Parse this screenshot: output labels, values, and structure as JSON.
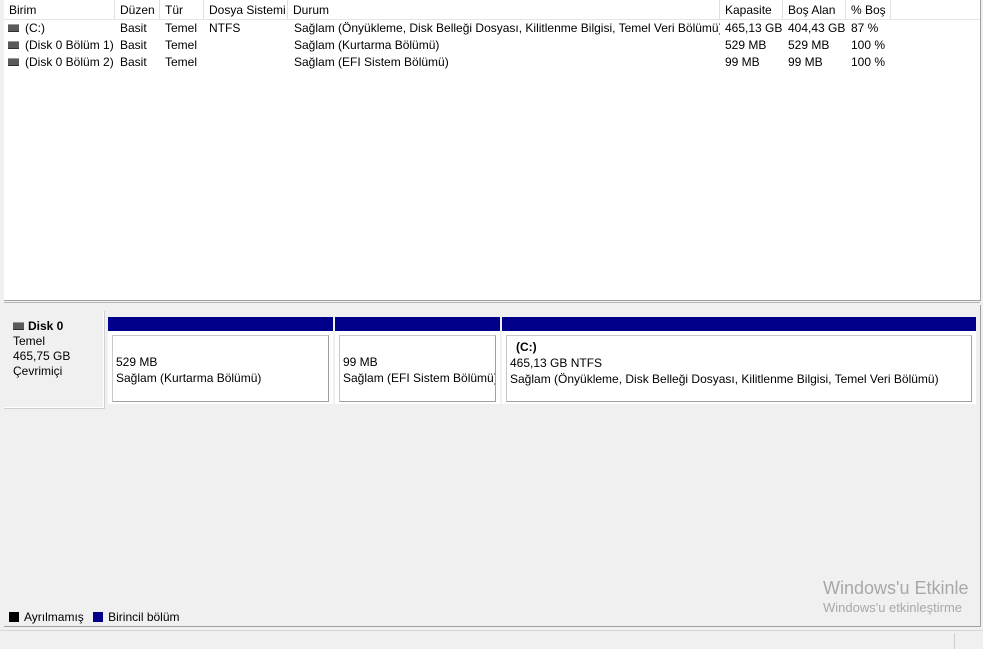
{
  "volume_list": {
    "columns": [
      "Birim",
      "Düzen",
      "Tür",
      "Dosya Sistemi",
      "Durum",
      "Kapasite",
      "Boş Alan",
      "% Boş"
    ],
    "rows": [
      {
        "icon": "disk-volume-icon",
        "name": "(C:)",
        "layout": "Basit",
        "type": "Temel",
        "fs": "NTFS",
        "status": "Sağlam (Önyükleme, Disk Belleği Dosyası, Kilitlenme Bilgisi, Temel Veri Bölümü)",
        "capacity": "465,13 GB",
        "free": "404,43 GB",
        "pct": "87 %"
      },
      {
        "icon": "disk-volume-icon",
        "name": "(Disk 0 Bölüm 1)",
        "layout": "Basit",
        "type": "Temel",
        "fs": "",
        "status": "Sağlam (Kurtarma Bölümü)",
        "capacity": "529 MB",
        "free": "529 MB",
        "pct": "100 %"
      },
      {
        "icon": "disk-volume-icon",
        "name": "(Disk 0 Bölüm 2)",
        "layout": "Basit",
        "type": "Temel",
        "fs": "",
        "status": "Sağlam (EFI Sistem Bölümü)",
        "capacity": "99 MB",
        "free": "99 MB",
        "pct": "100 %"
      }
    ]
  },
  "disk": {
    "icon": "disk-drive-icon",
    "name": "Disk 0",
    "type": "Temel",
    "size": "465,75 GB",
    "state": "Çevrimiçi",
    "partitions": [
      {
        "title": "",
        "size": "529 MB",
        "status": "Sağlam (Kurtarma Bölümü)"
      },
      {
        "title": "",
        "size": "99 MB",
        "status": "Sağlam (EFI Sistem Bölümü)"
      },
      {
        "title": "(C:)",
        "size": "465,13 GB NTFS",
        "status": "Sağlam (Önyükleme, Disk Belleği Dosyası, Kilitlenme Bilgisi, Temel Veri Bölümü)"
      }
    ]
  },
  "legend": [
    {
      "label": "Ayrılmamış",
      "color": "#000000"
    },
    {
      "label": "Birincil bölüm",
      "color": "#00008b"
    }
  ],
  "watermark": {
    "line1": "Windows'u Etkinle",
    "line2": "Windows'u etkinleştirme"
  },
  "colors": {
    "primary_partition": "#00008b",
    "unallocated": "#000000"
  }
}
